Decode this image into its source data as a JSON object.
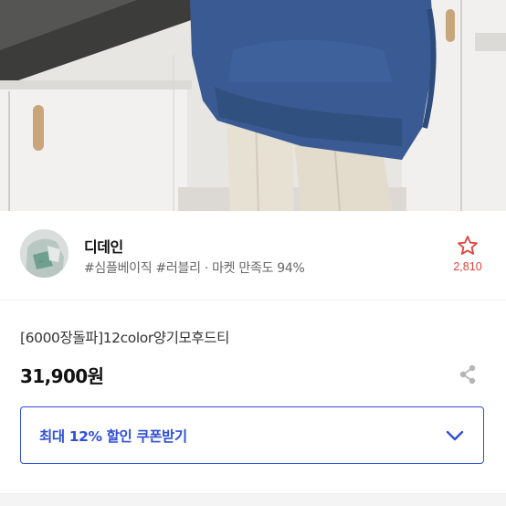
{
  "photo": {
    "description_icon": "product-photo-hoodie"
  },
  "store": {
    "avatar_icon": "store-avatar",
    "name": "디데인",
    "tags": "#심플베이직 #러블리 · 마켓 만족도 94%",
    "favorite_icon": "star-outline-icon",
    "favorite_count": "2,810"
  },
  "product": {
    "title": "[6000장돌파]12color양기모후드티",
    "price": "31,900원",
    "share_icon": "share-icon"
  },
  "coupon": {
    "label": "최대 12% 할인 쿠폰받기",
    "chevron_icon": "chevron-down-icon"
  },
  "colors": {
    "accent": "#2f4fd8",
    "favorite": "#e0433f",
    "hoodie": "#3a5a94"
  }
}
